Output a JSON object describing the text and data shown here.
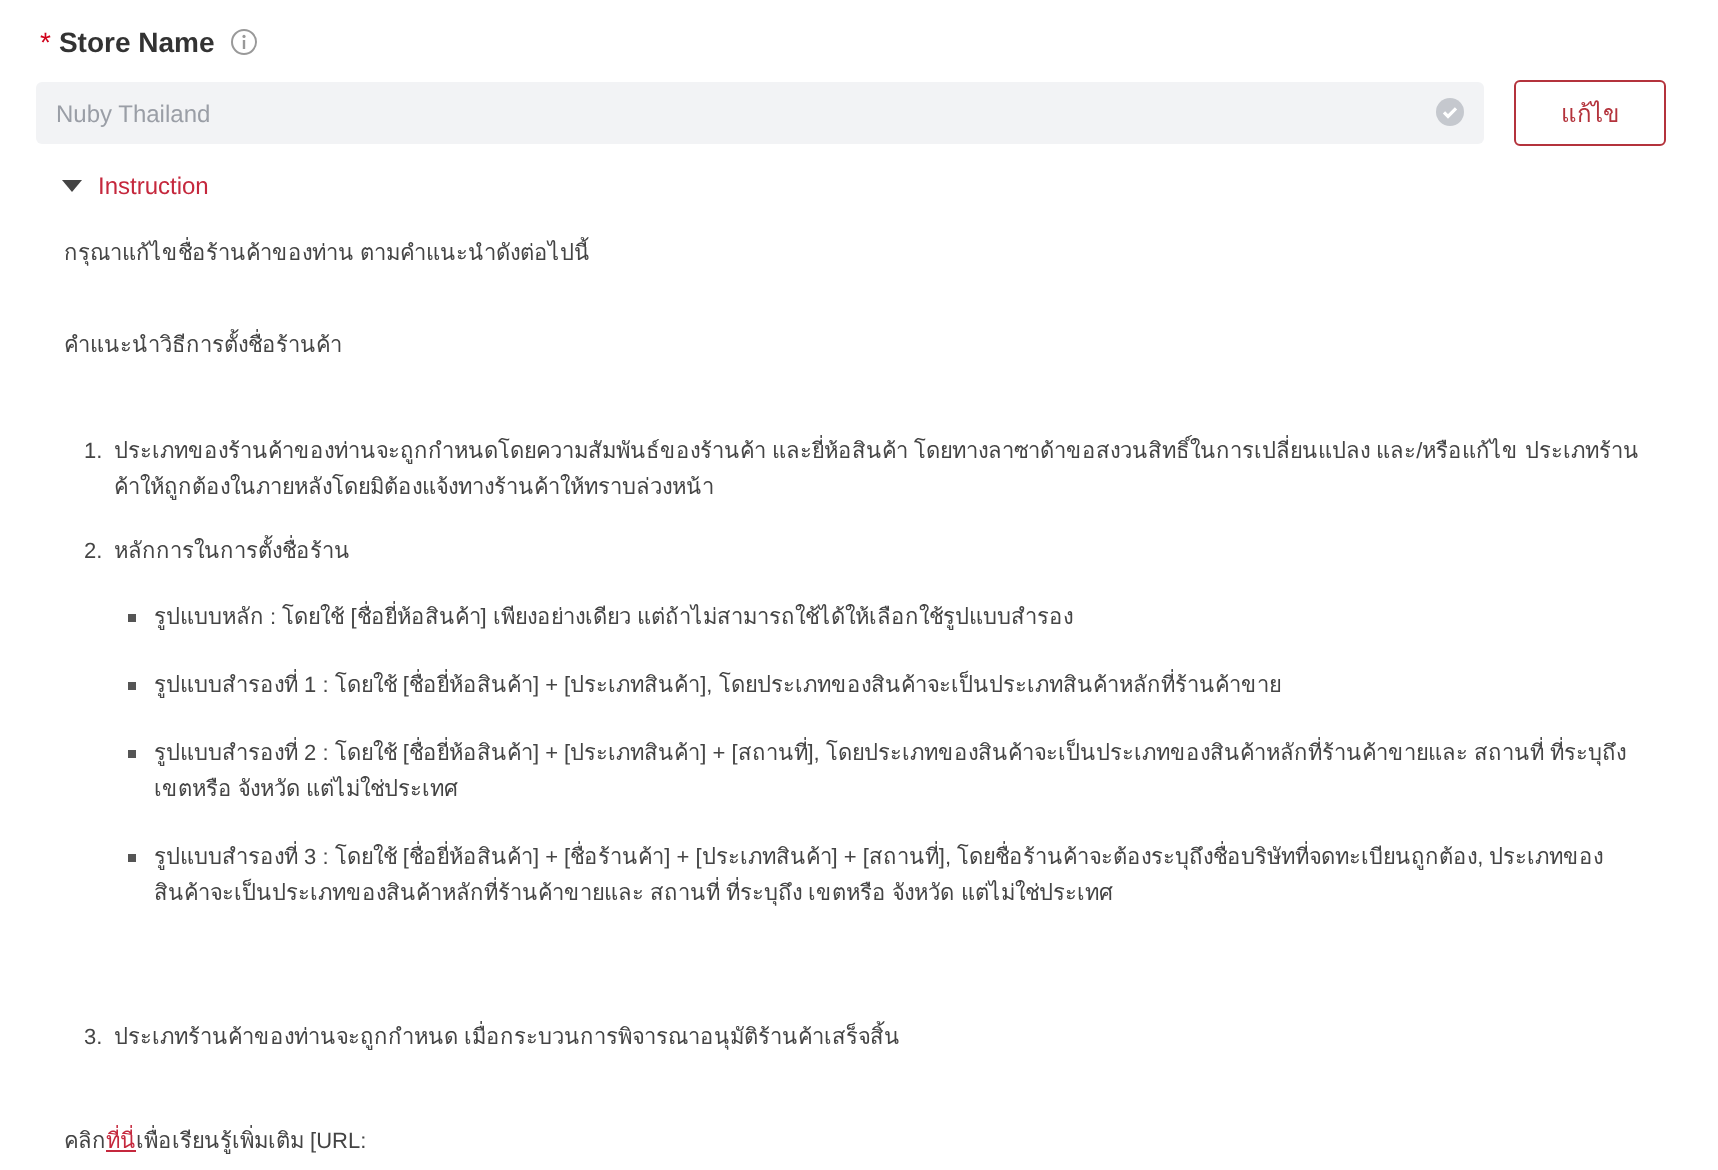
{
  "field": {
    "required_mark": "*",
    "label": "Store Name",
    "value": "Nuby Thailand",
    "disabled": true,
    "verified": true
  },
  "edit_button": "แก้ไข",
  "instruction": {
    "title": "Instruction",
    "expanded": true,
    "intro": "กรุณาแก้ไขชื่อร้านค้าของท่าน ตามคำแนะนำดังต่อไปนี้",
    "heading": "คำแนะนำวิธีการตั้งชื่อร้านค้า",
    "steps": [
      {
        "number": "1.",
        "text": "ประเภทของร้านค้าของท่านจะถูกกำหนดโดยความสัมพันธ์ของร้านค้า และยี่ห้อสินค้า โดยทางลาซาด้าขอสงวนสิทธิ์ในการเปลี่ยนแปลง และ/หรือแก้ไข ประเภทร้านค้าให้ถูกต้องในภายหลังโดยมิต้องแจ้งทางร้านค้าให้ทราบล่วงหน้า"
      },
      {
        "number": "2.",
        "text": "หลักการในการตั้งชื่อร้าน",
        "bullets": [
          "รูปแบบหลัก : โดยใช้ [ชื่อยี่ห้อสินค้า] เพียงอย่างเดียว แต่ถ้าไม่สามารถใช้ได้ให้เลือกใช้รูปแบบสำรอง",
          "รูปแบบสำรองที่ 1 : โดยใช้ [ชื่อยี่ห้อสินค้า] + [ประเภทสินค้า], โดยประเภทของสินค้าจะเป็นประเภทสินค้าหลักที่ร้านค้าขาย",
          "รูปแบบสำรองที่ 2 : โดยใช้ [ชื่อยี่ห้อสินค้า] + [ประเภทสินค้า] + [สถานที่], โดยประเภทของสินค้าจะเป็นประเภทของสินค้าหลักที่ร้านค้าขายและ สถานที่ ที่ระบุถึง เขตหรือ จังหวัด แต่ไม่ใช่ประเทศ",
          "รูปแบบสำรองที่ 3 : โดยใช้ [ชื่อยี่ห้อสินค้า] + [ชื่อร้านค้า] + [ประเภทสินค้า] + [สถานที่], โดยชื่อร้านค้าจะต้องระบุถึงชื่อบริษัทที่จดทะเบียนถูกต้อง, ประเภทของสินค้าจะเป็นประเภทของสินค้าหลักที่ร้านค้าขายและ สถานที่ ที่ระบุถึง เขตหรือ จังหวัด แต่ไม่ใช่ประเทศ"
        ]
      },
      {
        "number": "3.",
        "text": "ประเภทร้านค้าของท่านจะถูกกำหนด เมื่อกระบวนการพิจารณาอนุมัติร้านค้าเสร็จสิ้น"
      }
    ],
    "more": {
      "before": "คลิก",
      "link": "ที่นี่",
      "after": "เพื่อเรียนรู้เพิ่มเติม [URL:"
    }
  }
}
